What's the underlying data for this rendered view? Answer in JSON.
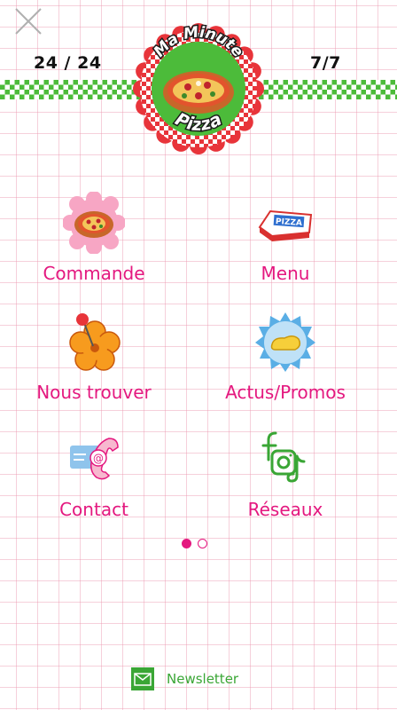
{
  "header": {
    "hours_left": "24 / 24",
    "hours_right": "7/7",
    "logo_line1": "Ma Minute",
    "logo_line2": "Pizza"
  },
  "menu": {
    "items": [
      {
        "label": "Commande",
        "icon": "pizza-flower-icon"
      },
      {
        "label": "Menu",
        "icon": "pizza-box-icon"
      },
      {
        "label": "Nous trouver",
        "icon": "map-pin-flower-icon"
      },
      {
        "label": "Actus/Promos",
        "icon": "megaphone-badge-icon"
      },
      {
        "label": "Contact",
        "icon": "phone-email-icon"
      },
      {
        "label": "Réseaux",
        "icon": "social-networks-icon"
      }
    ]
  },
  "pagination": {
    "current": 1,
    "total": 2
  },
  "footer": {
    "newsletter_label": "Newsletter"
  },
  "colors": {
    "accent": "#e4187f",
    "green": "#4cbb3a",
    "grid": "#ec96af"
  }
}
